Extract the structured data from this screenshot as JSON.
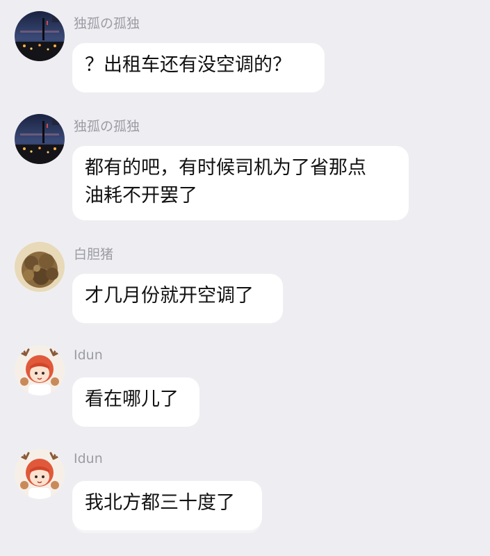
{
  "messages": [
    {
      "sender": "独孤の孤独",
      "avatar": "night-city-avatar",
      "text": "？出租车还有没空调的？"
    },
    {
      "sender": "独孤の孤独",
      "avatar": "night-city-avatar",
      "text": "都有的吧，有时候司机为了省那点\n油耗不开罢了"
    },
    {
      "sender": "白胆猪",
      "avatar": "brown-fluffy-avatar",
      "text": "才几月份就开空调了"
    },
    {
      "sender": "Idun",
      "avatar": "anime-deer-girl-avatar",
      "text": "看在哪儿了"
    },
    {
      "sender": "Idun",
      "avatar": "anime-deer-girl-avatar",
      "text": "我北方都三十度了"
    }
  ]
}
